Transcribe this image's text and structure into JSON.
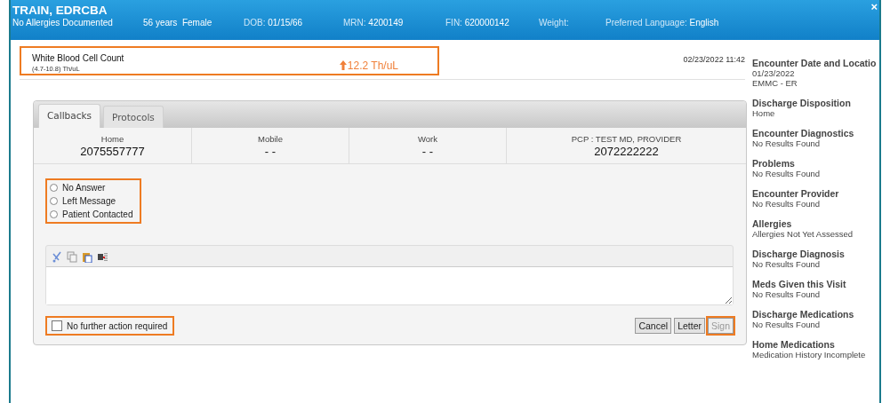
{
  "header": {
    "name": "TRAIN, EDRCBA",
    "close": "×",
    "fields": [
      {
        "value": "No Allergies Documented"
      },
      {
        "value": "56 years  Female"
      },
      {
        "label": "DOB:",
        "value": "01/15/66"
      },
      {
        "label": "MRN:",
        "value": "4200149"
      },
      {
        "label": "FIN:",
        "value": "620000142"
      },
      {
        "label": "Weight:"
      },
      {
        "label": "Preferred Language:",
        "value": "English"
      }
    ]
  },
  "result": {
    "name": "White Blood Cell Count",
    "range": "(4.7-10.8) Th/uL",
    "value": "12.2 Th/uL",
    "above_range": true,
    "datetime": "02/23/2022 11:42",
    "highlighted": true
  },
  "tabs": [
    {
      "label": "Callbacks",
      "selected": true
    },
    {
      "label": "Protocols",
      "selected": false
    }
  ],
  "phones": [
    {
      "label": "Home",
      "number": "2075557777"
    },
    {
      "label": "Mobile",
      "number": "- -"
    },
    {
      "label": "Work",
      "number": "- -"
    },
    {
      "label": "PCP :  TEST MD, PROVIDER",
      "number": "2072222222"
    }
  ],
  "outcomes": {
    "highlighted": true,
    "options": [
      {
        "label": "No Answer",
        "selected": false
      },
      {
        "label": "Left Message",
        "selected": false
      },
      {
        "label": "Patient Contacted",
        "selected": false
      }
    ]
  },
  "no_further_action": {
    "label": "No further action required",
    "checked": false,
    "highlighted": true
  },
  "buttons": [
    {
      "label": "Cancel",
      "disabled": false,
      "highlighted": false
    },
    {
      "label": "Letter",
      "disabled": false,
      "highlighted": false
    },
    {
      "label": "Sign",
      "disabled": true,
      "highlighted": true
    }
  ],
  "sidebar": [
    {
      "title": "Encounter Date and Locatio",
      "lines": [
        "01/23/2022",
        "EMMC - ER"
      ]
    },
    {
      "title": "Discharge Disposition",
      "lines": [
        "Home"
      ]
    },
    {
      "title": "Encounter Diagnostics",
      "lines": [
        "No Results Found"
      ]
    },
    {
      "title": "Problems",
      "lines": [
        "No Results Found"
      ]
    },
    {
      "title": "Encounter Provider",
      "lines": [
        "No Results Found"
      ]
    },
    {
      "title": "Allergies",
      "lines": [
        "Allergies Not Yet Assessed"
      ]
    },
    {
      "title": "Discharge Diagnosis",
      "lines": [
        "No Results Found"
      ]
    },
    {
      "title": "Meds Given this Visit",
      "lines": [
        "No Results Found"
      ]
    },
    {
      "title": "Discharge Medications",
      "lines": [
        "No Results Found"
      ]
    },
    {
      "title": "Home Medications",
      "lines": [
        "Medication History Incomplete"
      ]
    }
  ]
}
